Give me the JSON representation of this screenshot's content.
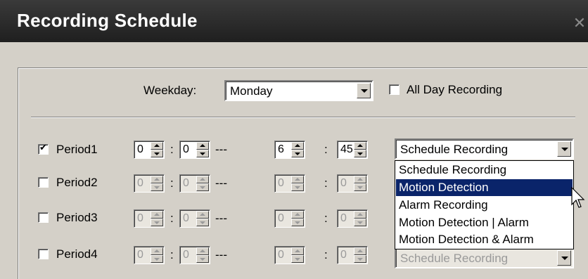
{
  "window": {
    "title": "Recording Schedule",
    "close_glyph": "✕"
  },
  "weekday": {
    "label": "Weekday:",
    "value": "Monday"
  },
  "all_day": {
    "label": "All Day Recording",
    "checked": false
  },
  "separators": {
    "colon": ":",
    "dash": "---"
  },
  "periods": [
    {
      "label": "Period1",
      "checked": true,
      "check_glyph": "✔",
      "start_h": "0",
      "start_m": "0",
      "end_h": "6",
      "end_m": "45",
      "mode": "Schedule Recording"
    },
    {
      "label": "Period2",
      "checked": false,
      "start_h": "0",
      "start_m": "0",
      "end_h": "0",
      "end_m": "0"
    },
    {
      "label": "Period3",
      "checked": false,
      "start_h": "0",
      "start_m": "0",
      "end_h": "0",
      "end_m": "0"
    },
    {
      "label": "Period4",
      "checked": false,
      "start_h": "0",
      "start_m": "0",
      "end_h": "0",
      "end_m": "0",
      "mode": "Schedule Recording"
    }
  ],
  "dropdown": {
    "options": [
      "Schedule Recording",
      "Motion Detection",
      "Alarm Recording",
      "Motion Detection | Alarm",
      "Motion Detection & Alarm"
    ],
    "highlighted_index": 1
  },
  "colors": {
    "titlebar": "#2a2a2a",
    "selection": "#0a246a",
    "dialog": "#d4d0c8"
  },
  "icons": {
    "cursor": "arrow-cursor-icon"
  }
}
